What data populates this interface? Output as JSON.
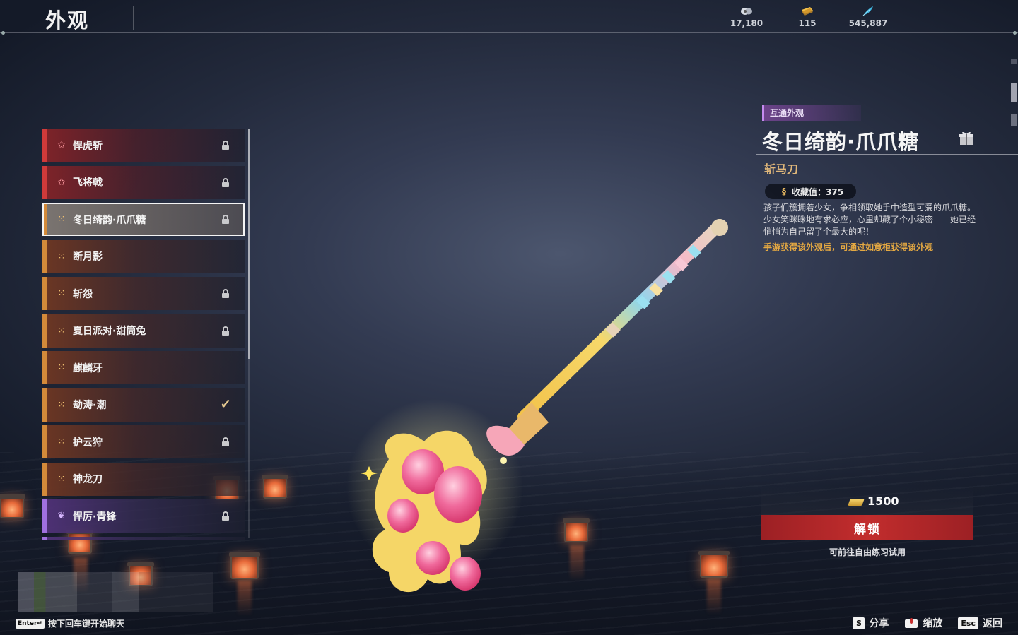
{
  "header": {
    "title": "外观",
    "currencies": [
      {
        "icon": "coin-stack-icon",
        "value": "17,180"
      },
      {
        "icon": "ticket-icon",
        "value": "115"
      },
      {
        "icon": "feather-icon",
        "value": "545,887"
      }
    ]
  },
  "skins": [
    {
      "name": "悍虎斩",
      "rarity": "red",
      "icon": "star-outline-icon",
      "status": "locked"
    },
    {
      "name": "飞将戟",
      "rarity": "red",
      "icon": "star-outline-icon",
      "status": "locked"
    },
    {
      "name": "冬日绮韵·爪爪糖",
      "rarity": "gold",
      "icon": "quad-icon",
      "status": "locked",
      "selected": true
    },
    {
      "name": "断月影",
      "rarity": "gold",
      "icon": "quad-icon",
      "status": "none"
    },
    {
      "name": "斩怨",
      "rarity": "gold",
      "icon": "quad-icon",
      "status": "locked"
    },
    {
      "name": "夏日派对·甜筒兔",
      "rarity": "gold",
      "icon": "quad-icon",
      "status": "locked"
    },
    {
      "name": "麒麟牙",
      "rarity": "gold",
      "icon": "quad-icon",
      "status": "none"
    },
    {
      "name": "劫涛·潮",
      "rarity": "gold",
      "icon": "quad-icon",
      "status": "equipped"
    },
    {
      "name": "护云狩",
      "rarity": "gold",
      "icon": "quad-icon",
      "status": "locked"
    },
    {
      "name": "神龙刀",
      "rarity": "gold",
      "icon": "quad-icon",
      "status": "none"
    },
    {
      "name": "悍厉·青锋",
      "rarity": "purple",
      "icon": "gem-icon",
      "status": "locked"
    }
  ],
  "detail": {
    "tag": "互通外观",
    "title": "冬日绮韵·爪爪糖",
    "subtype": "斩马刀",
    "collect_label": "收藏值：375",
    "description": "孩子们簇拥着少女，争相领取她手中造型可爱的爪爪糖。少女笑眯眯地有求必应，心里却藏了个小秘密——她已经悄悄为自己留了个最大的呢！",
    "note": "手游获得该外观后，可通过如意柜获得该外观",
    "price": "1500",
    "unlock_label": "解锁",
    "trial_label": "可前往自由练习试用"
  },
  "chat": {
    "key": "Enter↵",
    "hint": "按下回车键开始聊天"
  },
  "footer": {
    "hints": [
      {
        "key": "S",
        "label": "分享"
      },
      {
        "key": "zoom-icon",
        "label": "缩放"
      },
      {
        "key": "Esc",
        "label": "返回"
      }
    ]
  },
  "colors": {
    "accent_red": "#c22d2d",
    "gold_text": "#e0b77a",
    "note_orange": "#e5a942",
    "rarity_gold": "#d38a3a",
    "rarity_red": "#d03a3a",
    "rarity_purple": "#a070e0"
  }
}
